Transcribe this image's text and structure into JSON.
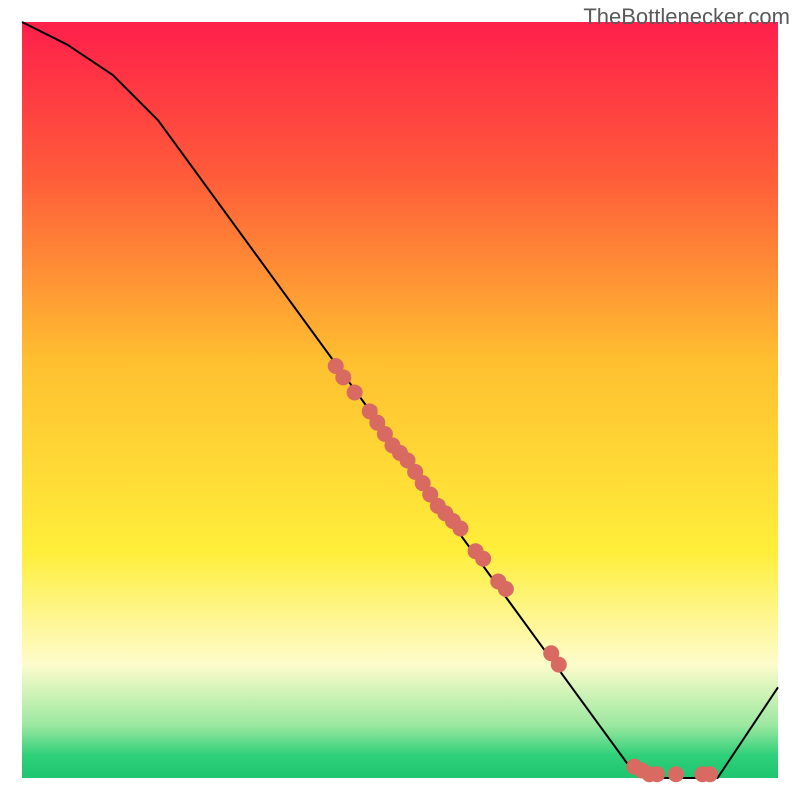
{
  "attribution": "TheBottlenecker.com",
  "chart_data": {
    "type": "line",
    "title": "",
    "xlabel": "",
    "ylabel": "",
    "xlim": [
      0,
      100
    ],
    "ylim": [
      0,
      100
    ],
    "background_gradient": {
      "stops": [
        {
          "offset": 0.0,
          "color": "#ff1f4b"
        },
        {
          "offset": 0.2,
          "color": "#ff5a3a"
        },
        {
          "offset": 0.45,
          "color": "#ffc030"
        },
        {
          "offset": 0.7,
          "color": "#ffee3a"
        },
        {
          "offset": 0.85,
          "color": "#fdfccc"
        },
        {
          "offset": 0.93,
          "color": "#9ce8a0"
        },
        {
          "offset": 0.97,
          "color": "#2fd07a"
        },
        {
          "offset": 1.0,
          "color": "#1fc56f"
        }
      ]
    },
    "series": [
      {
        "name": "curve",
        "color": "#000000",
        "stroke_width": 2,
        "x": [
          0,
          6,
          12,
          18,
          80,
          84,
          88,
          92,
          100
        ],
        "y": [
          100,
          97,
          93,
          87,
          2,
          0,
          0,
          0,
          12
        ]
      }
    ],
    "points": {
      "name": "markers",
      "color": "#d86a62",
      "radius": 8,
      "x": [
        41.5,
        42.5,
        44.0,
        46.0,
        47.0,
        48.0,
        49.0,
        50.0,
        51.0,
        52.0,
        53.0,
        54.0,
        55.0,
        56.0,
        57.0,
        58.0,
        60.0,
        61.0,
        63.0,
        64.0,
        70.0,
        71.0,
        81.0,
        82.0,
        83.0,
        84.0,
        86.5,
        90.0,
        91.0
      ],
      "y": [
        54.5,
        53.0,
        51.0,
        48.5,
        47.0,
        45.5,
        44.0,
        43.0,
        42.0,
        40.5,
        39.0,
        37.5,
        36.0,
        35.0,
        34.0,
        33.0,
        30.0,
        29.0,
        26.0,
        25.0,
        16.5,
        15.0,
        1.5,
        1.0,
        0.5,
        0.5,
        0.5,
        0.5,
        0.5
      ]
    }
  }
}
